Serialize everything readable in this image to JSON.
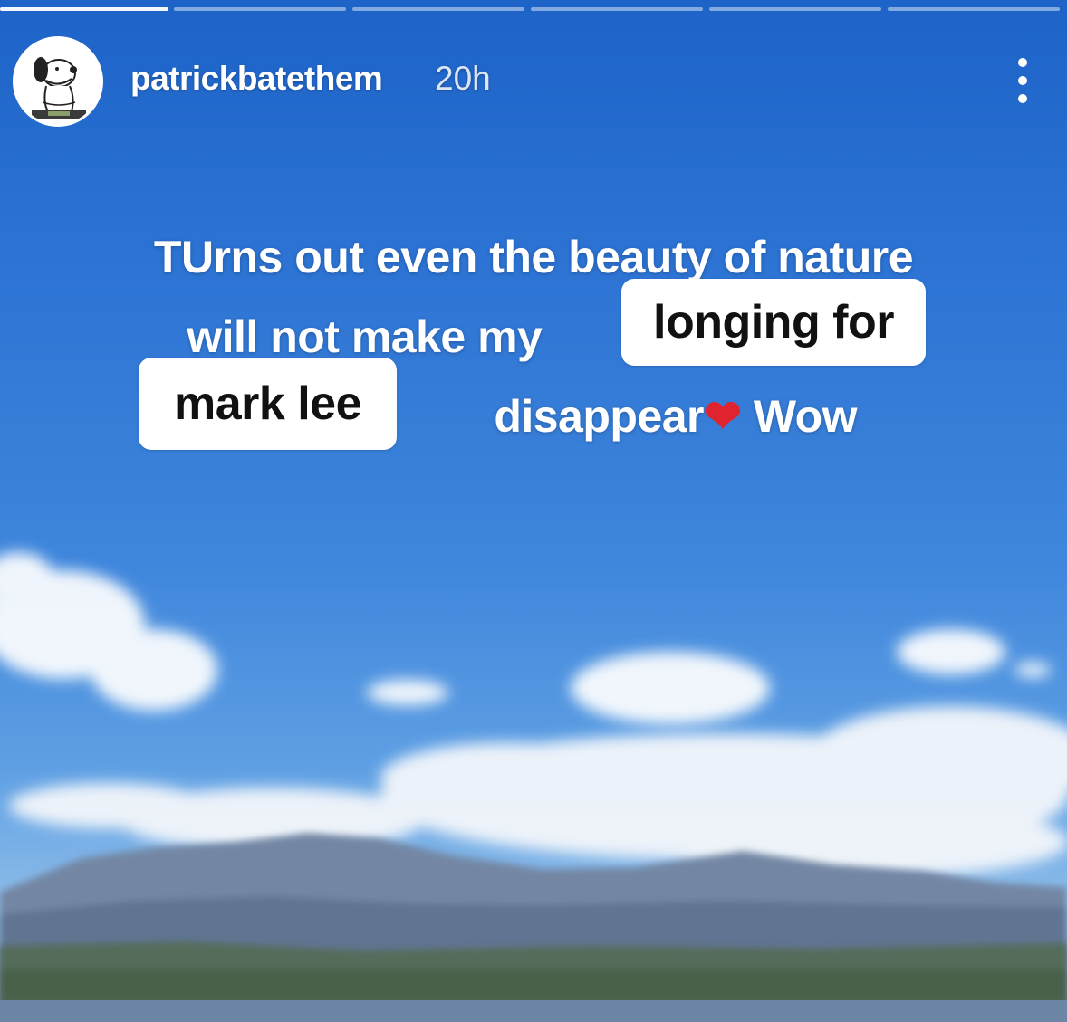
{
  "story": {
    "progress_segments": 6,
    "current_segment": 1,
    "user": {
      "username": "patrickbatethem",
      "time_ago": "20h",
      "avatar_icon": "snoopy-avatar-icon"
    },
    "more_icon": "more-vertical-icon",
    "caption": {
      "line1": "TUrns out even the beauty of nature",
      "line2_prefix": "will not make my",
      "line3_suffix": "disappear",
      "emoji": "❤️",
      "line3_end": "Wow"
    },
    "stickers": {
      "longing": "longing for",
      "mark": "mark lee"
    }
  },
  "colors": {
    "sky_top": "#1d63c8",
    "sky_bottom": "#8bbbe9",
    "text": "#ffffff",
    "sticker_bg": "#ffffff",
    "sticker_text": "#111111",
    "heart": "#e0242f"
  }
}
